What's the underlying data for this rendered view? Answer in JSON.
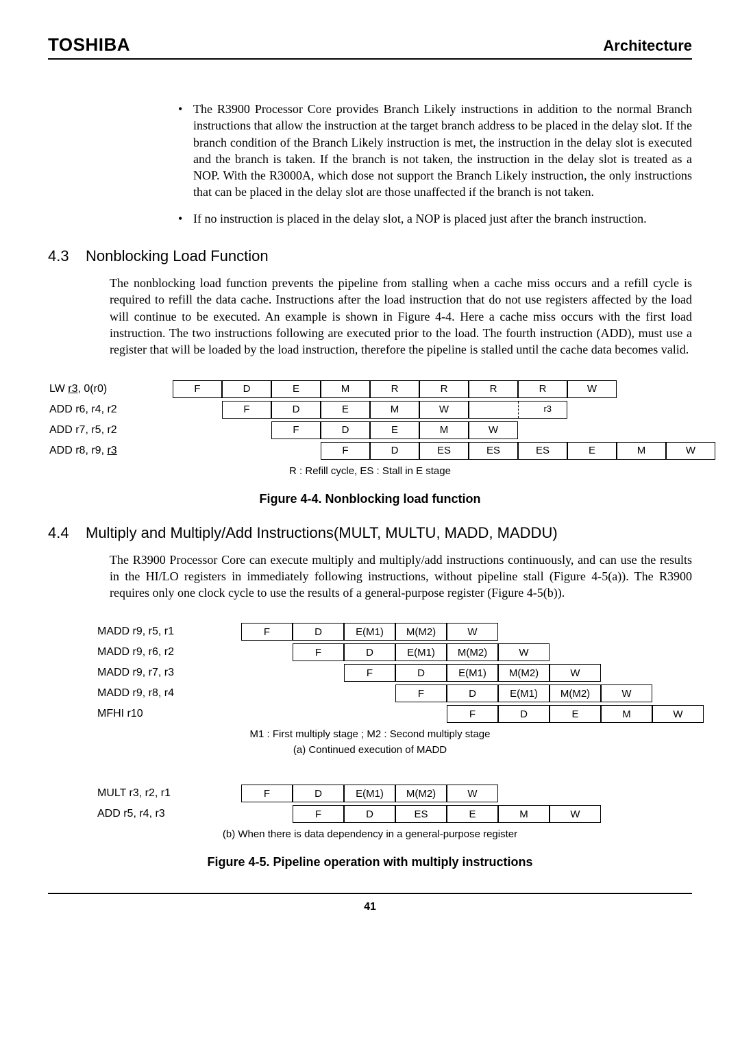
{
  "header": {
    "brand": "TOSHIBA",
    "section": "Architecture"
  },
  "bullets": [
    "The R3900 Processor Core provides Branch Likely instructions in addition to the normal Branch instructions that allow the instruction at the target branch address to be placed in the delay slot.    If the branch condition of the Branch Likely instruction is met, the instruction in the delay slot is executed and the branch is taken.    If the branch is not taken, the instruction in the delay slot is treated as a NOP.    With the R3000A, which dose not support the Branch Likely instruction, the only instructions that can be placed in the delay slot are those unaffected if the branch is not taken.",
    "If no instruction is placed in the delay slot, a NOP is placed just after the branch instruction."
  ],
  "sect43": {
    "num": "4.3",
    "title": "Nonblocking Load Function"
  },
  "body43": "The nonblocking load function prevents the pipeline from stalling when a cache miss occurs and a refill cycle is required to refill the data cache.    Instructions after the load instruction that do not use registers affected by the load will continue to be executed.    An example is shown in Figure 4-4.    Here a cache miss occurs with the first load instruction.    The two instructions following are executed prior to the load.    The fourth instruction (ADD), must use a register that will be loaded by the load instruction, therefore the pipeline is stalled until the cache data becomes valid.",
  "pipe1": {
    "rows": [
      {
        "label": "LW r3, 0(r0)",
        "offset": 0,
        "cells": [
          "F",
          "D",
          "E",
          "M",
          "R",
          "R",
          "R",
          "R",
          "W"
        ]
      },
      {
        "label": "ADD r6, r4, r2",
        "offset": 1,
        "cells": [
          "F",
          "D",
          "E",
          "M",
          "W",
          "_MERGE_",
          "_r3"
        ]
      },
      {
        "label": "ADD r7, r5, r2",
        "offset": 2,
        "cells": [
          "F",
          "D",
          "E",
          "M",
          "W"
        ]
      },
      {
        "label": "ADD r8, r9, r3",
        "offset": 3,
        "cells": [
          "F",
          "D",
          "ES",
          "ES",
          "ES",
          "E",
          "M",
          "W"
        ]
      }
    ],
    "note": "R : Refill cycle, ES : Stall in E stage",
    "caption": "Figure 4-4. Nonblocking load function"
  },
  "sect44": {
    "num": "4.4",
    "title": "Multiply and Multiply/Add Instructions(MULT, MULTU, MADD, MADDU)"
  },
  "body44": "The R3900 Processor Core can execute multiply and multiply/add instructions continuously, and can use the results in the HI/LO registers in immediately following instructions, without pipeline stall (Figure 4-5(a)). The R3900 requires only one clock cycle to use the results of a general-purpose register (Figure 4-5(b)).",
  "pipe2a": {
    "rows": [
      {
        "label": "MADD r9, r5, r1",
        "offset": 0,
        "cells": [
          "F",
          "D",
          "E(M1)",
          "M(M2)",
          "W"
        ]
      },
      {
        "label": "MADD r9, r6, r2",
        "offset": 1,
        "cells": [
          "F",
          "D",
          "E(M1)",
          "M(M2)",
          "W"
        ]
      },
      {
        "label": "MADD r9, r7, r3",
        "offset": 2,
        "cells": [
          "F",
          "D",
          "E(M1)",
          "M(M2)",
          "W"
        ]
      },
      {
        "label": "MADD r9, r8, r4",
        "offset": 3,
        "cells": [
          "F",
          "D",
          "E(M1)",
          "M(M2)",
          "W"
        ]
      },
      {
        "label": "MFHI r10",
        "offset": 4,
        "cells": [
          "F",
          "D",
          "E",
          "M",
          "W"
        ]
      }
    ],
    "note1": "M1 : First multiply stage ; M2 : Second multiply stage",
    "note2": "(a) Continued execution of MADD"
  },
  "pipe2b": {
    "rows": [
      {
        "label": "MULT r3, r2, r1",
        "offset": 0,
        "cells": [
          "F",
          "D",
          "E(M1)",
          "M(M2)",
          "W"
        ]
      },
      {
        "label": "ADD r5, r4, r3",
        "offset": 1,
        "cells": [
          "F",
          "D",
          "ES",
          "E",
          "M",
          "W"
        ]
      }
    ],
    "note": "(b) When there is data dependency in a general-purpose register",
    "caption": "Figure 4-5.    Pipeline operation with multiply instructions"
  },
  "pagenum": "41"
}
